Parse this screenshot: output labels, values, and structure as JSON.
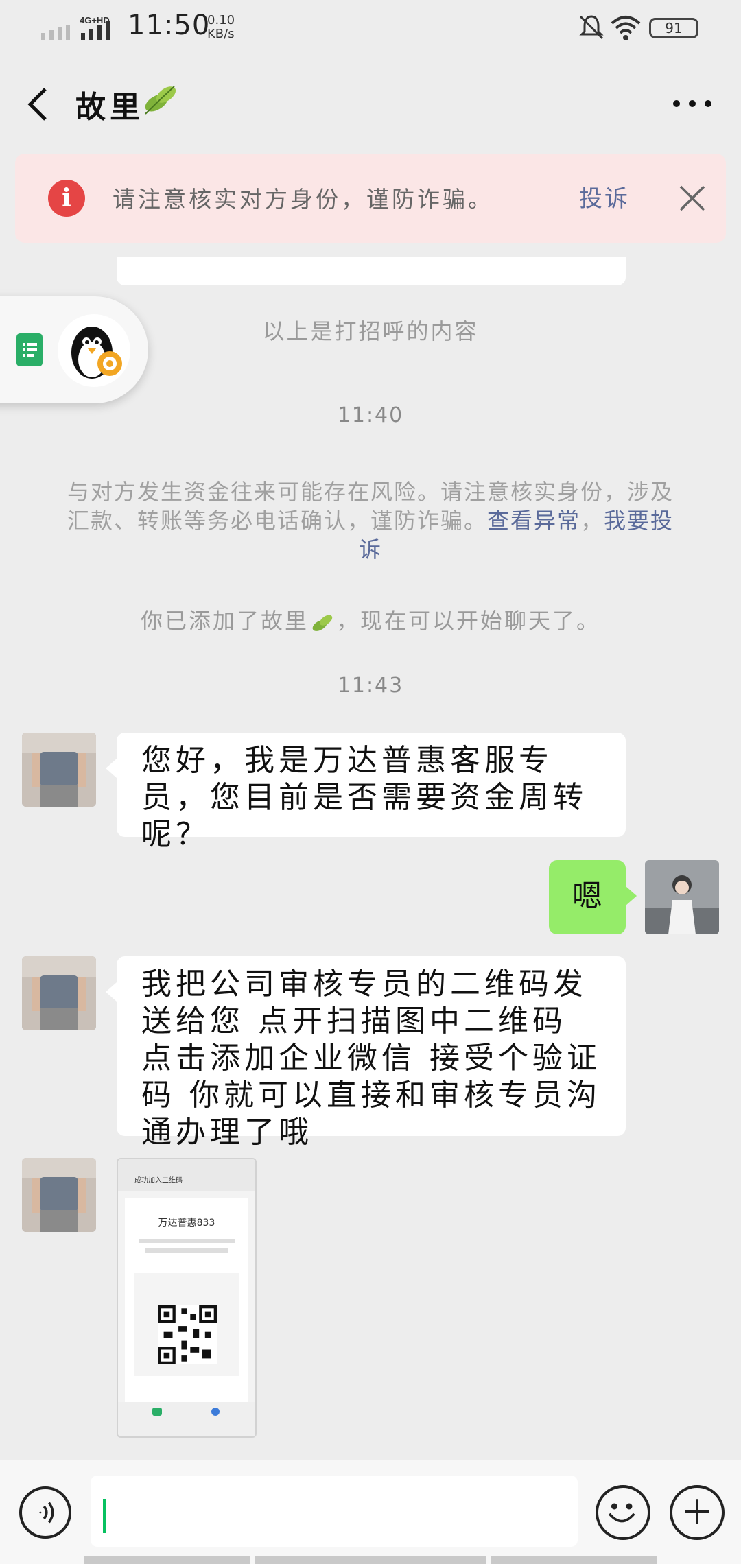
{
  "status_bar": {
    "network": "4G+HD",
    "time": "11:50",
    "speed_value": "0.10",
    "speed_unit": "KB/s",
    "battery": "91"
  },
  "header": {
    "title": "故里",
    "title_emoji_icon": "leaf-icon"
  },
  "banner": {
    "text": "请注意核实对方身份，谨防诈骗。",
    "report_label": "投诉"
  },
  "system": {
    "greeting_label": "以上是打招呼的内容",
    "time_1": "11:40",
    "risk_text": "与对方发生资金往来可能存在风险。请注意核实身份，涉及汇款、转账等务必电话确认，谨防诈骗。",
    "risk_link_1": "查看异常",
    "risk_separator": "，",
    "risk_link_2": "我要投诉",
    "added_prefix": "你已添加了故里",
    "added_suffix": "，现在可以开始聊天了。",
    "time_2": "11:43"
  },
  "messages": [
    {
      "from": "them",
      "text": "您好，我是万达普惠客服专员，您目前是否需要资金周转呢？"
    },
    {
      "from": "me",
      "text": "嗯"
    },
    {
      "from": "them",
      "text": "我把公司审核专员的二维码发送给您 点开扫描图中二维码 点击添加企业微信 接受个验证码 你就可以直接和审核专员沟通办理了哦"
    }
  ],
  "image_message": {
    "header": "成功加入二维码",
    "card_title": "万达普惠833"
  },
  "input": {
    "value": ""
  },
  "colors": {
    "bubble_self": "#95ec69",
    "link": "#5a6a9a",
    "warning_red": "#e54545"
  }
}
